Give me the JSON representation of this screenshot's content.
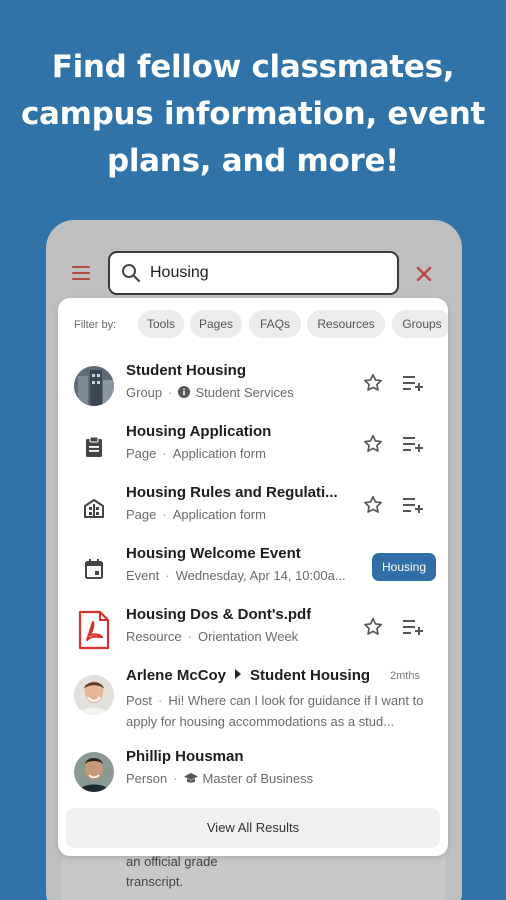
{
  "headline": {
    "line1": "Find fellow classmates,",
    "line2": "campus information, event",
    "line3": "plans, and more!"
  },
  "search": {
    "value": "Housing",
    "placeholder": ""
  },
  "filters": {
    "label": "Filter by:",
    "chips": [
      "Tools",
      "Pages",
      "FAQs",
      "Resources",
      "Groups"
    ]
  },
  "results": [
    {
      "title": "Student Housing",
      "type": "Group",
      "detail": "Student Services",
      "icon": "group-photo",
      "actions": [
        "star",
        "add-to-list"
      ]
    },
    {
      "title": "Housing Application",
      "type": "Page",
      "detail": "Application form",
      "icon": "clipboard",
      "actions": [
        "star",
        "add-to-list"
      ]
    },
    {
      "title": "Housing Rules and Regulati...",
      "type": "Page",
      "detail": "Application form",
      "icon": "building",
      "actions": [
        "star",
        "add-to-list"
      ]
    },
    {
      "title": "Housing Welcome Event",
      "type": "Event",
      "detail": "Wednesday, Apr 14, 10:00a...",
      "icon": "calendar",
      "badge": "Housing"
    },
    {
      "title": "Housing Dos & Dont's.pdf",
      "type": "Resource",
      "detail": "Orientation Week",
      "icon": "pdf",
      "actions": [
        "star",
        "add-to-list"
      ]
    },
    {
      "author": "Arlene McCoy",
      "target": "Student Housing",
      "time": "2mths",
      "type": "Post",
      "detail": "Hi! Where can I look for guidance if I want to apply for housing accommodations as a stud...",
      "icon": "avatar-arlene"
    },
    {
      "title": "Phillip Housman",
      "type": "Person",
      "detail": "Master of Business",
      "icon": "avatar-phillip"
    }
  ],
  "view_all_label": "View All Results",
  "background_text": {
    "line1": "an official grade",
    "line2": "transcript."
  },
  "colors": {
    "page_bg": "#2f73a8",
    "accent_red": "#b54b3f",
    "badge_blue": "#2f6ea6",
    "pdf_red": "#d9322b"
  }
}
